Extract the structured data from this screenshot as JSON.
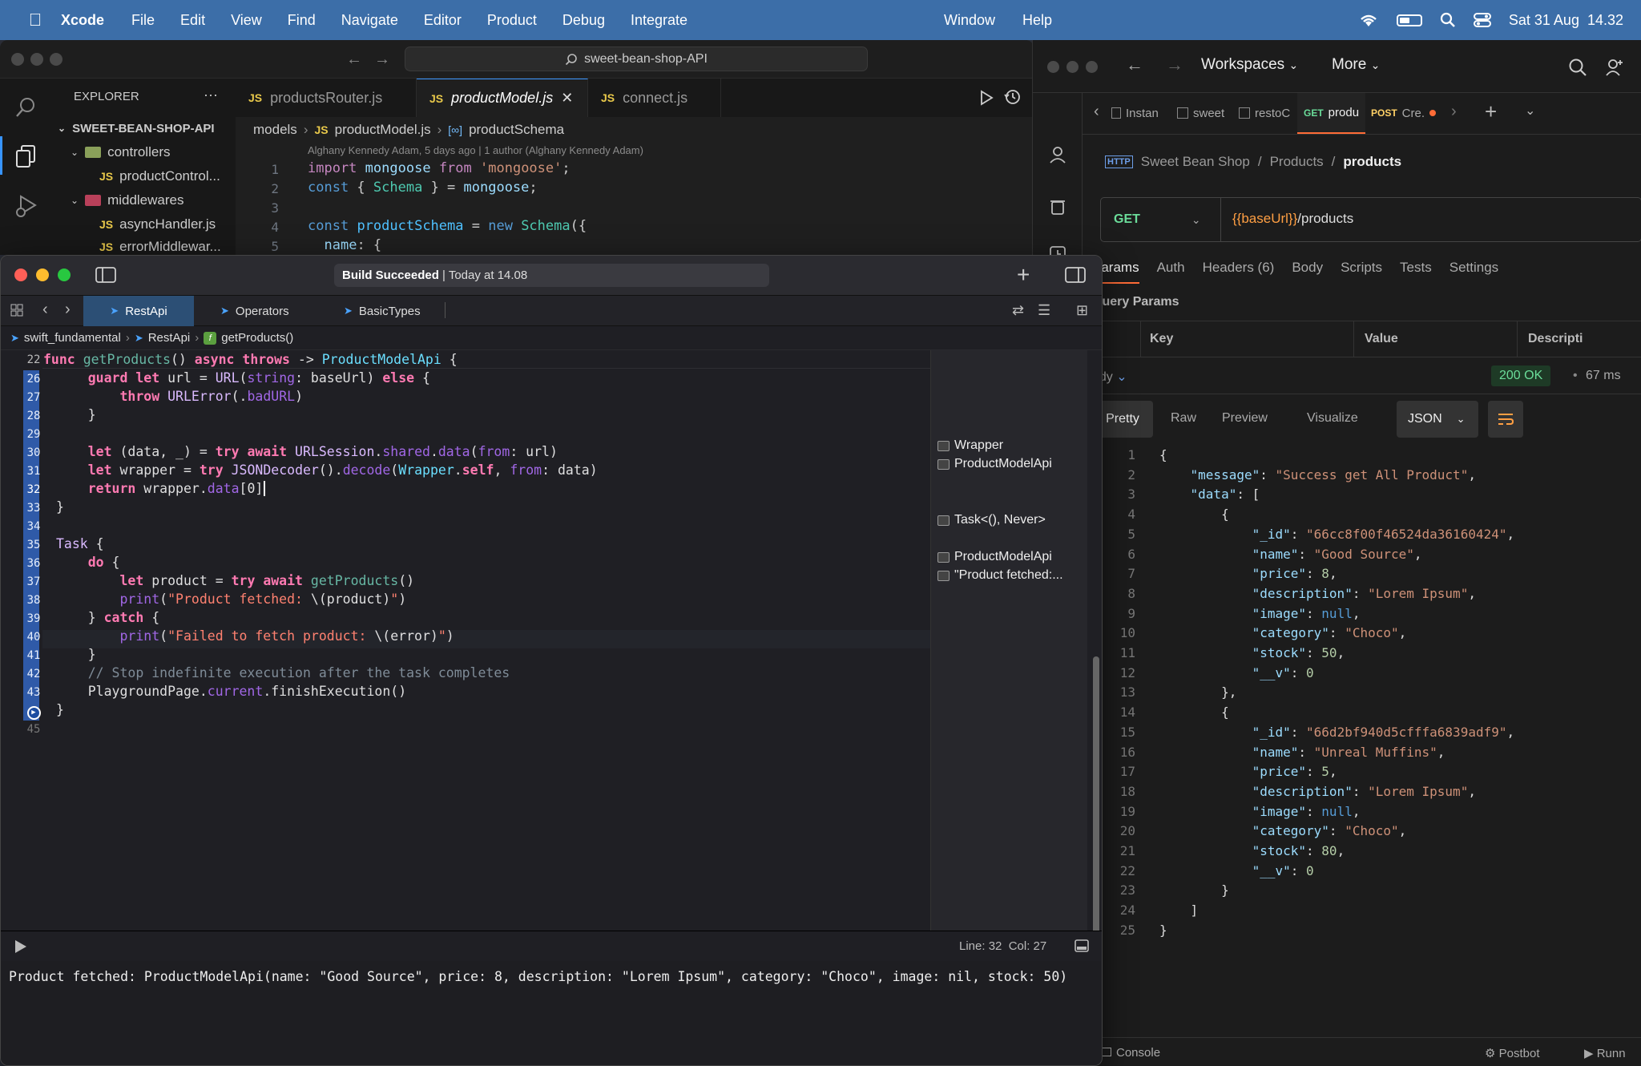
{
  "menubar": {
    "app": "Xcode",
    "items": [
      "File",
      "Edit",
      "View",
      "Find",
      "Navigate",
      "Editor",
      "Product",
      "Debug",
      "Integrate"
    ],
    "right_items": [
      "Window",
      "Help"
    ],
    "clock": "Sat 31 Aug  14.32"
  },
  "vscode": {
    "search": "sweet-bean-shop-API",
    "explorer_title": "EXPLORER",
    "explorer_more": "···",
    "project": "SWEET-BEAN-SHOP-API",
    "tree": [
      {
        "label": "controllers",
        "kind": "folder"
      },
      {
        "label": "productControl...",
        "kind": "js"
      },
      {
        "label": "middlewares",
        "kind": "folder"
      },
      {
        "label": "asyncHandler.js",
        "kind": "js"
      },
      {
        "label": "errorMiddlewar...",
        "kind": "js"
      }
    ],
    "tabs": [
      "productsRouter.js",
      "productModel.js",
      "connect.js"
    ],
    "js_badge": "JS",
    "breadcrumb": {
      "folder": "models",
      "file": "productModel.js",
      "symbol": "productSchema"
    },
    "blame": "Alghany Kennedy Adam, 5 days ago | 1 author (Alghany Kennedy Adam)",
    "lines": [
      {
        "n": "1",
        "text": "import mongoose from 'mongoose';"
      },
      {
        "n": "2",
        "text": "const { Schema } = mongoose;"
      },
      {
        "n": "3",
        "text": ""
      },
      {
        "n": "4",
        "text": "const productSchema = new Schema({"
      },
      {
        "n": "5",
        "text": "  name: {"
      }
    ]
  },
  "postman": {
    "workspaces": "Workspaces",
    "more": "More",
    "tabs": [
      {
        "method": "",
        "label": "Instan"
      },
      {
        "method": "",
        "label": "sweet"
      },
      {
        "method": "",
        "label": "restoC"
      },
      {
        "method": "GET",
        "label": "produ"
      },
      {
        "method": "POST",
        "label": "Cre."
      }
    ],
    "breadcrumb": [
      "Sweet Bean Shop",
      "/",
      "Products",
      "/",
      "products"
    ],
    "method": "GET",
    "url_var": "{{baseUrl}}",
    "url_path": "/products",
    "req_tabs": [
      "Params",
      "Auth",
      "Headers (6)",
      "Body",
      "Scripts",
      "Tests",
      "Settings"
    ],
    "query_params_title": "Query Params",
    "table_headers": [
      "Key",
      "Value",
      "Descripti"
    ],
    "body_label": "ody",
    "status": "200 OK",
    "time": "67 ms",
    "view_tabs": [
      "Pretty",
      "Raw",
      "Preview",
      "Visualize"
    ],
    "format": "JSON",
    "console": "Console",
    "postbot": "Postbot",
    "runner": "Runn",
    "json_lines": [
      {
        "n": "1",
        "text": "{"
      },
      {
        "n": "2",
        "text": "    \"message\": \"Success get All Product\","
      },
      {
        "n": "3",
        "text": "    \"data\": ["
      },
      {
        "n": "4",
        "text": "        {"
      },
      {
        "n": "5",
        "text": "            \"_id\": \"66cc8f00f46524da36160424\","
      },
      {
        "n": "6",
        "text": "            \"name\": \"Good Source\","
      },
      {
        "n": "7",
        "text": "            \"price\": 8,"
      },
      {
        "n": "8",
        "text": "            \"description\": \"Lorem Ipsum\","
      },
      {
        "n": "9",
        "text": "            \"image\": null,"
      },
      {
        "n": "10",
        "text": "            \"category\": \"Choco\","
      },
      {
        "n": "11",
        "text": "            \"stock\": 50,"
      },
      {
        "n": "12",
        "text": "            \"__v\": 0"
      },
      {
        "n": "13",
        "text": "        },"
      },
      {
        "n": "14",
        "text": "        {"
      },
      {
        "n": "15",
        "text": "            \"_id\": \"66d2bf940d5cfffa6839adf9\","
      },
      {
        "n": "16",
        "text": "            \"name\": \"Unreal Muffins\","
      },
      {
        "n": "17",
        "text": "            \"price\": 5,"
      },
      {
        "n": "18",
        "text": "            \"description\": \"Lorem Ipsum\","
      },
      {
        "n": "19",
        "text": "            \"image\": null,"
      },
      {
        "n": "20",
        "text": "            \"category\": \"Choco\","
      },
      {
        "n": "21",
        "text": "            \"stock\": 80,"
      },
      {
        "n": "22",
        "text": "            \"__v\": 0"
      },
      {
        "n": "23",
        "text": "        }"
      },
      {
        "n": "24",
        "text": "    ]"
      },
      {
        "n": "25",
        "text": "}"
      }
    ]
  },
  "xcode": {
    "status_bold": "Build Succeeded",
    "status_rest": " | Today at 14.08",
    "tabs": [
      "RestApi",
      "Operators",
      "BasicTypes"
    ],
    "breadcrumb": [
      "swift_fundamental",
      "RestApi",
      "getProducts()"
    ],
    "header_line": {
      "n": "22",
      "text": "func getProducts() async throws -> ProductModelApi {"
    },
    "lines": [
      {
        "n": "26",
        "text": "    guard let url = URL(string: baseUrl) else {"
      },
      {
        "n": "27",
        "text": "        throw URLError(.badURL)"
      },
      {
        "n": "28",
        "text": "    }"
      },
      {
        "n": "29",
        "text": ""
      },
      {
        "n": "30",
        "text": "    let (data, _) = try await URLSession.shared.data(from: url)"
      },
      {
        "n": "31",
        "text": "    let wrapper = try JSONDecoder().decode(Wrapper.self, from: data)"
      },
      {
        "n": "32",
        "text": "    return wrapper.data[0]"
      },
      {
        "n": "33",
        "text": "}"
      },
      {
        "n": "34",
        "text": ""
      },
      {
        "n": "35",
        "text": "Task {"
      },
      {
        "n": "36",
        "text": "    do {"
      },
      {
        "n": "37",
        "text": "        let product = try await getProducts()"
      },
      {
        "n": "38",
        "text": "        print(\"Product fetched: \\(product)\")"
      },
      {
        "n": "39",
        "text": "    } catch {"
      },
      {
        "n": "40",
        "text": "        print(\"Failed to fetch product: \\(error)\")"
      },
      {
        "n": "41",
        "text": "    }"
      },
      {
        "n": "42",
        "text": "    // Stop indefinite execution after the task completes"
      },
      {
        "n": "43",
        "text": "    PlaygroundPage.current.finishExecution()"
      },
      {
        "n": "44",
        "text": "}"
      },
      {
        "n": "45",
        "text": ""
      }
    ],
    "results": [
      {
        "label": "Wrapper"
      },
      {
        "label": "ProductModelApi"
      },
      {
        "label": "Task<(), Never>"
      },
      {
        "label": "ProductModelApi"
      },
      {
        "label": "\"Product fetched:..."
      }
    ],
    "cursor": "Line: 32  Col: 27",
    "console_output": "Product fetched: ProductModelApi(name: \"Good Source\", price: 8, description: \"Lorem Ipsum\", category: \"Choco\", image: nil, stock: 50)"
  }
}
